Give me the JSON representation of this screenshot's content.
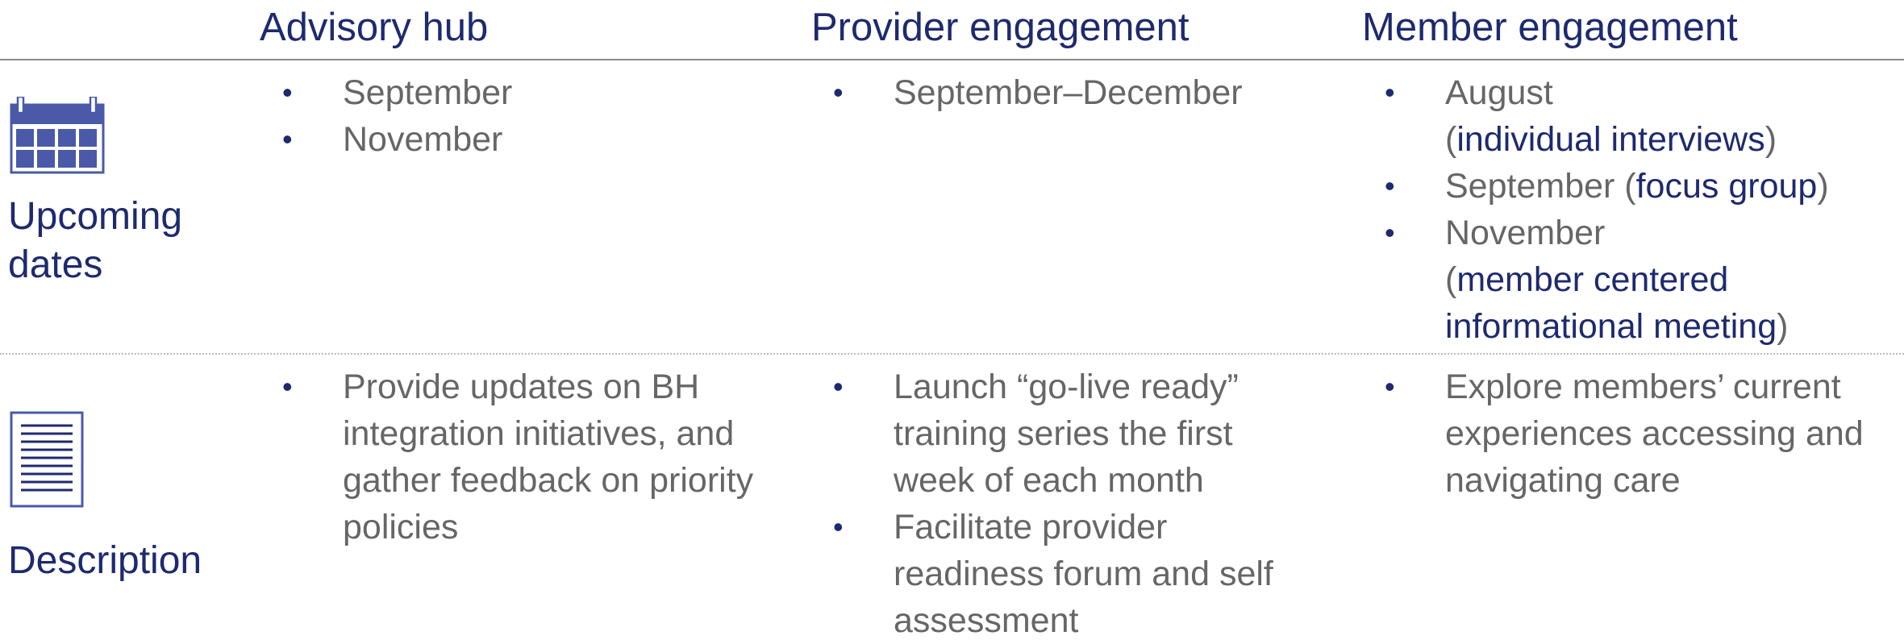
{
  "headers": {
    "advisory": "Advisory hub",
    "provider": "Provider engagement",
    "member": "Member engagement"
  },
  "rows": {
    "dates": {
      "label_line1": "Upcoming",
      "label_line2": "dates",
      "icon": "calendar-icon",
      "advisory": [
        "September",
        "November"
      ],
      "provider": [
        "September–December"
      ],
      "member": {
        "item1_plain": "August",
        "item1_open": "(",
        "item1_accent": "individual interviews",
        "item1_close": ")",
        "item2_plain": "September (",
        "item2_accent": "focus group",
        "item2_close": ")",
        "item3_plain": "November",
        "item3_open": "(",
        "item3_accent_line1": "member centered",
        "item3_accent_line2": "informational meeting",
        "item3_close": ")"
      }
    },
    "description": {
      "label": "Description",
      "icon": "document-icon",
      "advisory": [
        "Provide updates on BH integration initiatives, and gather feedback on priority policies"
      ],
      "provider": [
        "Launch “go-live ready” training series the first week of each month",
        "Facilitate provider readiness forum and self assessment"
      ],
      "member": [
        "Explore members’ current experiences accessing and navigating care"
      ]
    }
  },
  "colors": {
    "accent": "#1e2a6e",
    "text": "#666666",
    "icon": "#4a5aa8"
  }
}
